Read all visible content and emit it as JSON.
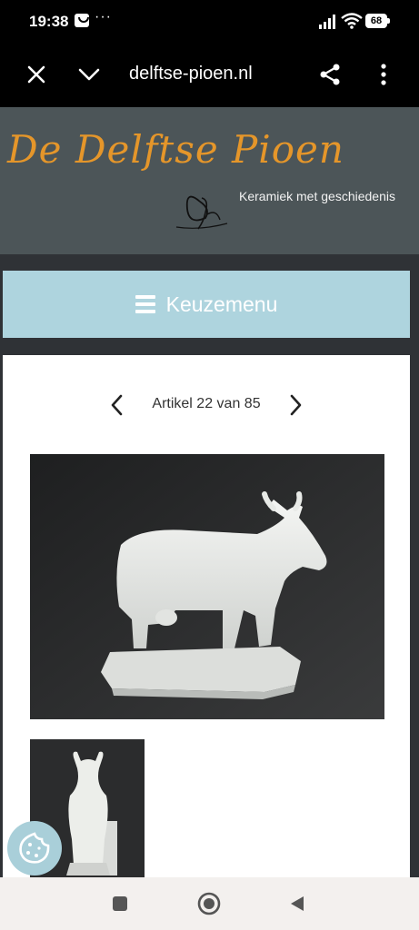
{
  "status_bar": {
    "time": "19:38",
    "more": "···",
    "battery": "68"
  },
  "browser": {
    "url": "delftse-pioen.nl",
    "icons": [
      "close-icon",
      "chevron-down-icon",
      "share-icon",
      "more-vertical-icon"
    ]
  },
  "site": {
    "title": "De Delftse Pioen",
    "tagline": "Keramiek met geschiedenis"
  },
  "menu": {
    "label": "Keuzemenu"
  },
  "pager": {
    "text": "Artikel 22 van 85"
  },
  "gallery": {
    "main_alt": "White porcelain cow figurine",
    "thumb_alt": "White porcelain cow figurine, front view"
  },
  "colors": {
    "header_bg": "#4c5558",
    "title_orange": "#e5962a",
    "menu_bg": "#aed4de",
    "page_bg": "#2f3236"
  }
}
